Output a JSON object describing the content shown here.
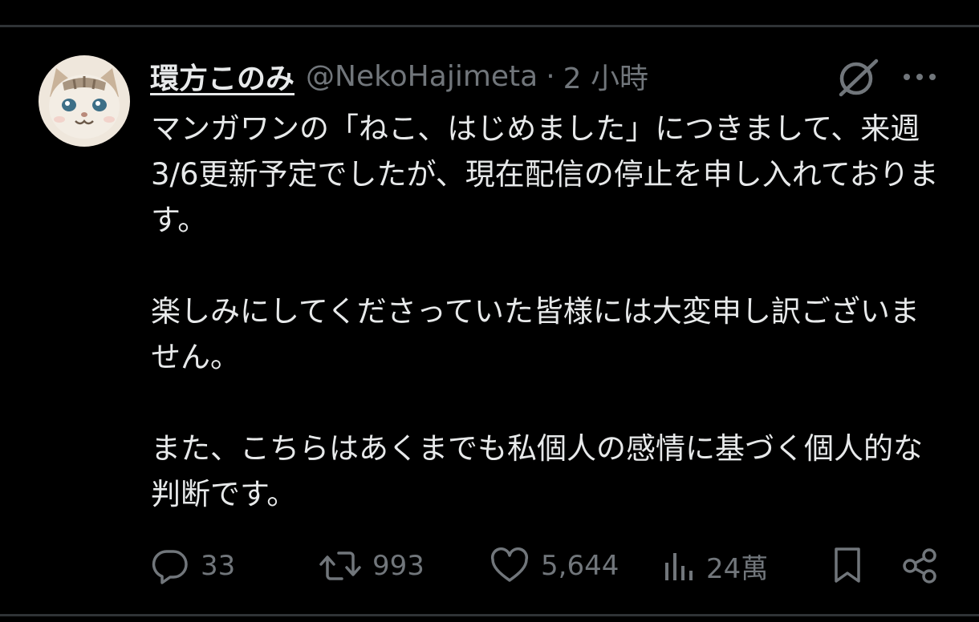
{
  "tweet": {
    "display_name": "環方このみ",
    "handle": "@NekoHajimeta",
    "separator": "·",
    "time": "2 小時",
    "paragraphs": [
      "マンガワンの「ねこ、はじめました」につきまして、来週3/6更新予定でしたが、現在配信の停止を申し入れております。",
      "楽しみにしてくださっていた皆様には大変申し訳ございません。",
      "また、こちらはあくまでも私個人の感情に基づく個人的な判断です。"
    ]
  },
  "actions": {
    "reply_count": "33",
    "retweet_count": "993",
    "like_count": "5,644",
    "views_count": "24萬"
  },
  "icons": {
    "avatar": "cat-avatar",
    "grok": "grok-icon",
    "more": "more-icon",
    "reply": "reply-icon",
    "retweet": "retweet-icon",
    "like": "like-icon",
    "views": "views-icon",
    "bookmark": "bookmark-icon",
    "share": "share-icon"
  },
  "colors": {
    "background": "#000000",
    "text_primary": "#e7e9ea",
    "text_secondary": "#71767b",
    "divider": "#2f3336"
  }
}
